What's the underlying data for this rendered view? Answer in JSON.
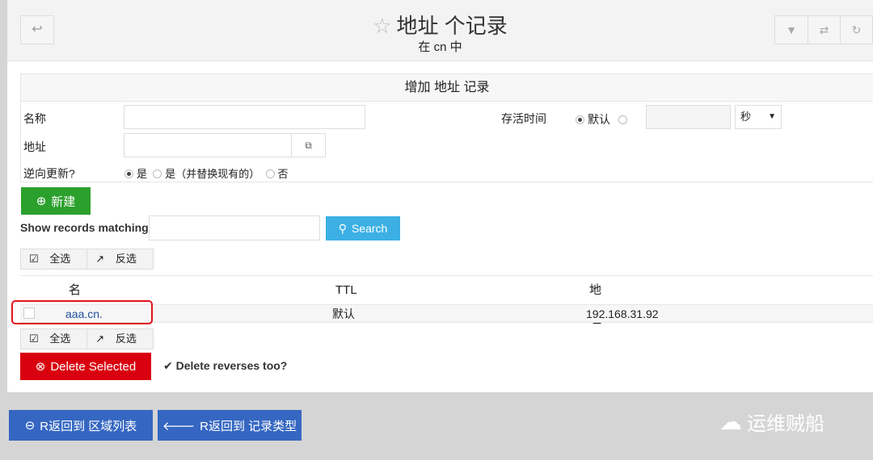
{
  "header": {
    "title": "地址 个记录",
    "subtitle": "在 cn 中"
  },
  "form": {
    "heading": "增加 地址 记录",
    "name_label": "名称",
    "name_value": "",
    "ttl_label": "存活时间",
    "ttl_default": "默认",
    "ttl_value": "",
    "ttl_unit": "秒",
    "address_label": "地址",
    "address_value": "",
    "reverse_label": "逆向更新?",
    "reverse_opts": [
      "是",
      "是（并替换现有的）",
      "否"
    ],
    "reverse_selected": "是"
  },
  "new_button": "新建",
  "search": {
    "label": "Show records matching:",
    "value": "",
    "button": "Search"
  },
  "select_all": "全选",
  "invert": "反选",
  "table": {
    "columns": [
      "名称",
      "TTL",
      "地址"
    ],
    "rows": [
      {
        "name": "aaa.cn.",
        "ttl": "默认",
        "address": "192.168.31.92",
        "checked": false
      }
    ]
  },
  "delete_button": "Delete Selected",
  "delete_reverses": {
    "label": "Delete reverses too?",
    "checked": true
  },
  "footer": {
    "back_zones": "R返回到 区域列表",
    "back_types": "R返回到 记录类型"
  },
  "watermark": "运维贼船",
  "colors": {
    "green": "#2ca02c",
    "blue_search": "#3cb0e4",
    "red": "#d9000f",
    "nav_blue": "#3567c2",
    "link": "#1f4e9c"
  }
}
